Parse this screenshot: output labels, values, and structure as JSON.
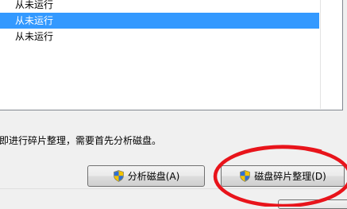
{
  "schedule_list": {
    "items": [
      {
        "last_run": "从未运行",
        "selected": false
      },
      {
        "last_run": "从未运行",
        "selected": true
      },
      {
        "last_run": "从未运行",
        "selected": false
      }
    ]
  },
  "info_text": "即进行碎片整理，需要首先分析磁盘。",
  "buttons": {
    "analyze_label": "分析磁盘(A)",
    "defrag_label": "磁盘碎片整理(D)"
  },
  "icons": {
    "analyze_button_icon": "uac-shield-icon",
    "defrag_button_icon": "uac-shield-icon"
  },
  "colors": {
    "selection": "#3399ff",
    "annotation_circle": "#e8141b"
  }
}
